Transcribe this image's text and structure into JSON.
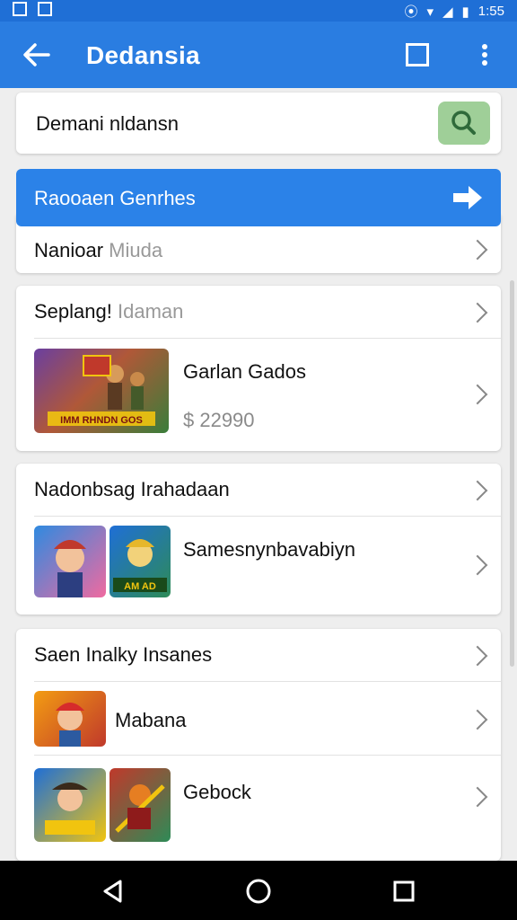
{
  "status": {
    "time": "1:55"
  },
  "appbar": {
    "title": "Dedansia"
  },
  "search": {
    "query": "Demani nldansn"
  },
  "banner": {
    "label": "Raooaen Genrhes"
  },
  "sections": {
    "s0": {
      "label_main": "Nanioar",
      "label_sub": "Miuda"
    },
    "s1": {
      "title_main": "Seplang!",
      "title_sub": "Idaman",
      "item_name": "Garlan Gados",
      "item_price": "$ 22990",
      "thumb_text": "IMM RHNDN GOS"
    },
    "s2": {
      "title": "Nadonbsag Irahadaan",
      "item_name": "Samesnynbavabiyn",
      "thumb_text": "AM AD"
    },
    "s3": {
      "title": "Saen Inalky Insanes",
      "item1_name": "Mabana",
      "item2_name": "Gebock"
    }
  }
}
